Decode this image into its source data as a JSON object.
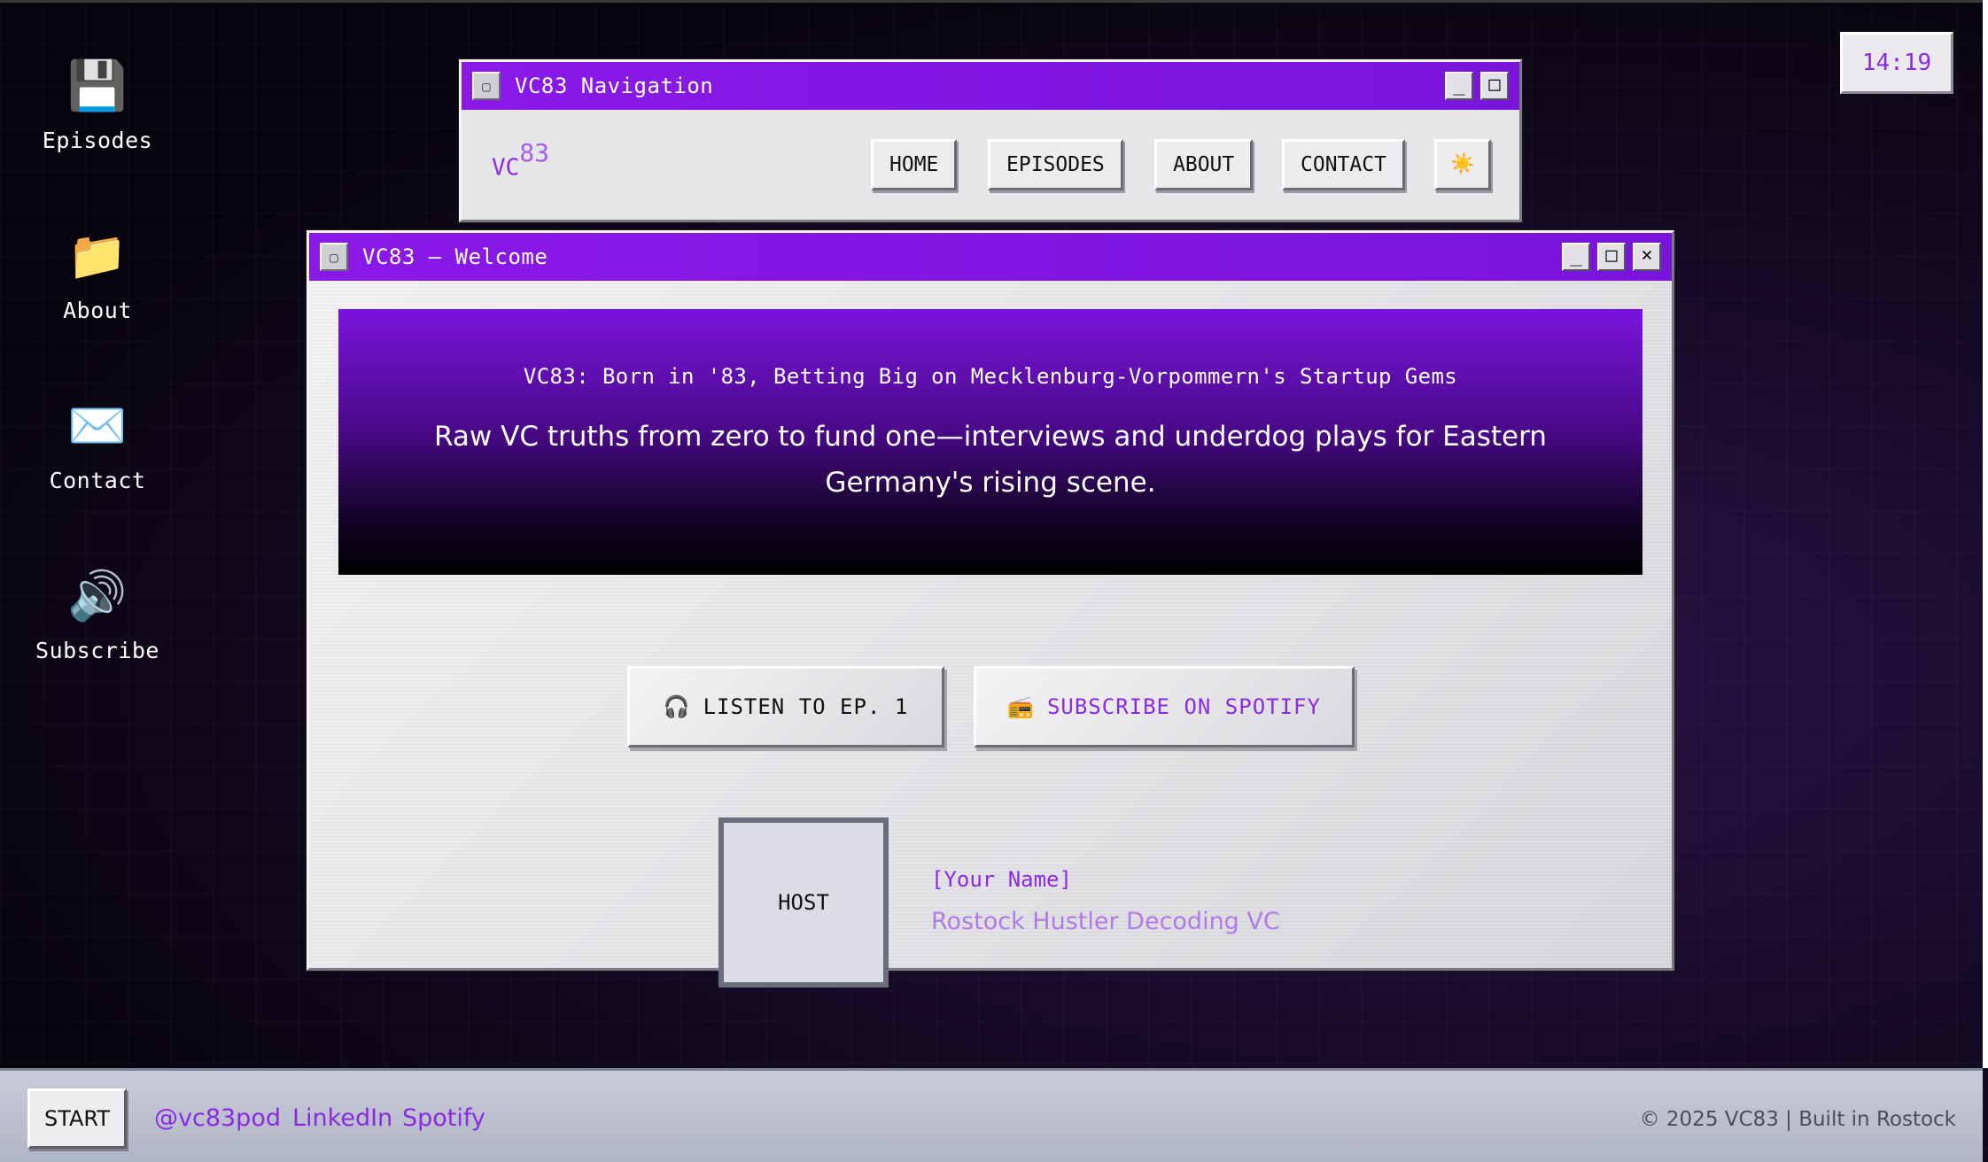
{
  "desktop": {
    "icons": [
      {
        "label": "Episodes",
        "glyph": "💾",
        "icon": "floppy-disk-icon"
      },
      {
        "label": "About",
        "glyph": "📁",
        "icon": "folder-icon"
      },
      {
        "label": "Contact",
        "glyph": "✉️",
        "icon": "envelope-icon"
      },
      {
        "label": "Subscribe",
        "glyph": "🔊",
        "icon": "speaker-icon"
      }
    ]
  },
  "clock": {
    "time": "14:19"
  },
  "nav_window": {
    "title": "VC83 Navigation",
    "logo_text": "VC",
    "logo_sup": "83",
    "buttons": {
      "minimize": "_",
      "maximize": "□"
    },
    "nav": {
      "home": "HOME",
      "episodes": "EPISODES",
      "about": "ABOUT",
      "contact": "CONTACT",
      "theme": "☀️"
    }
  },
  "main_window": {
    "title": "VC83 – Welcome",
    "buttons": {
      "minimize": "_",
      "maximize": "□",
      "close": "×"
    },
    "hero": {
      "title": "VC83: Born in '83, Betting Big on Mecklenburg-Vorpommern's Startup Gems",
      "subtitle": "Raw VC truths from zero to fund one—interviews and underdog plays for Eastern Germany's rising scene."
    },
    "cta": {
      "listen_icon": "🎧",
      "listen_label": "LISTEN TO EP. 1",
      "subscribe_icon": "📻",
      "subscribe_label": "SUBSCRIBE ON SPOTIFY"
    },
    "host": {
      "box_label": "HOST",
      "name": "[Your Name]",
      "role": "Rostock Hustler Decoding VC"
    }
  },
  "taskbar": {
    "start_label": "START",
    "links": [
      "@vc83pod",
      "LinkedIn",
      "Spotify"
    ],
    "copyright": "© 2025 VC83 | Built in Rostock"
  },
  "colors": {
    "accent": "#8a2be2",
    "titlebar": "#8a19e8"
  }
}
